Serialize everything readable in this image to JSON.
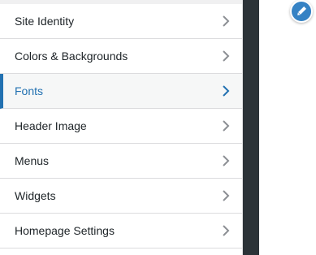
{
  "sidebar": {
    "items": [
      {
        "label": "Site Identity",
        "active": false
      },
      {
        "label": "Colors & Backgrounds",
        "active": false
      },
      {
        "label": "Fonts",
        "active": true
      },
      {
        "label": "Header Image",
        "active": false
      },
      {
        "label": "Menus",
        "active": false
      },
      {
        "label": "Widgets",
        "active": false
      },
      {
        "label": "Homepage Settings",
        "active": false
      }
    ]
  },
  "icons": {
    "chevron": "chevron-right-icon",
    "edit_shortcut": "pencil-icon"
  },
  "colors": {
    "accent": "#2271b1",
    "preview_bg": "#2c3338",
    "edit_button": "#3582c4"
  }
}
